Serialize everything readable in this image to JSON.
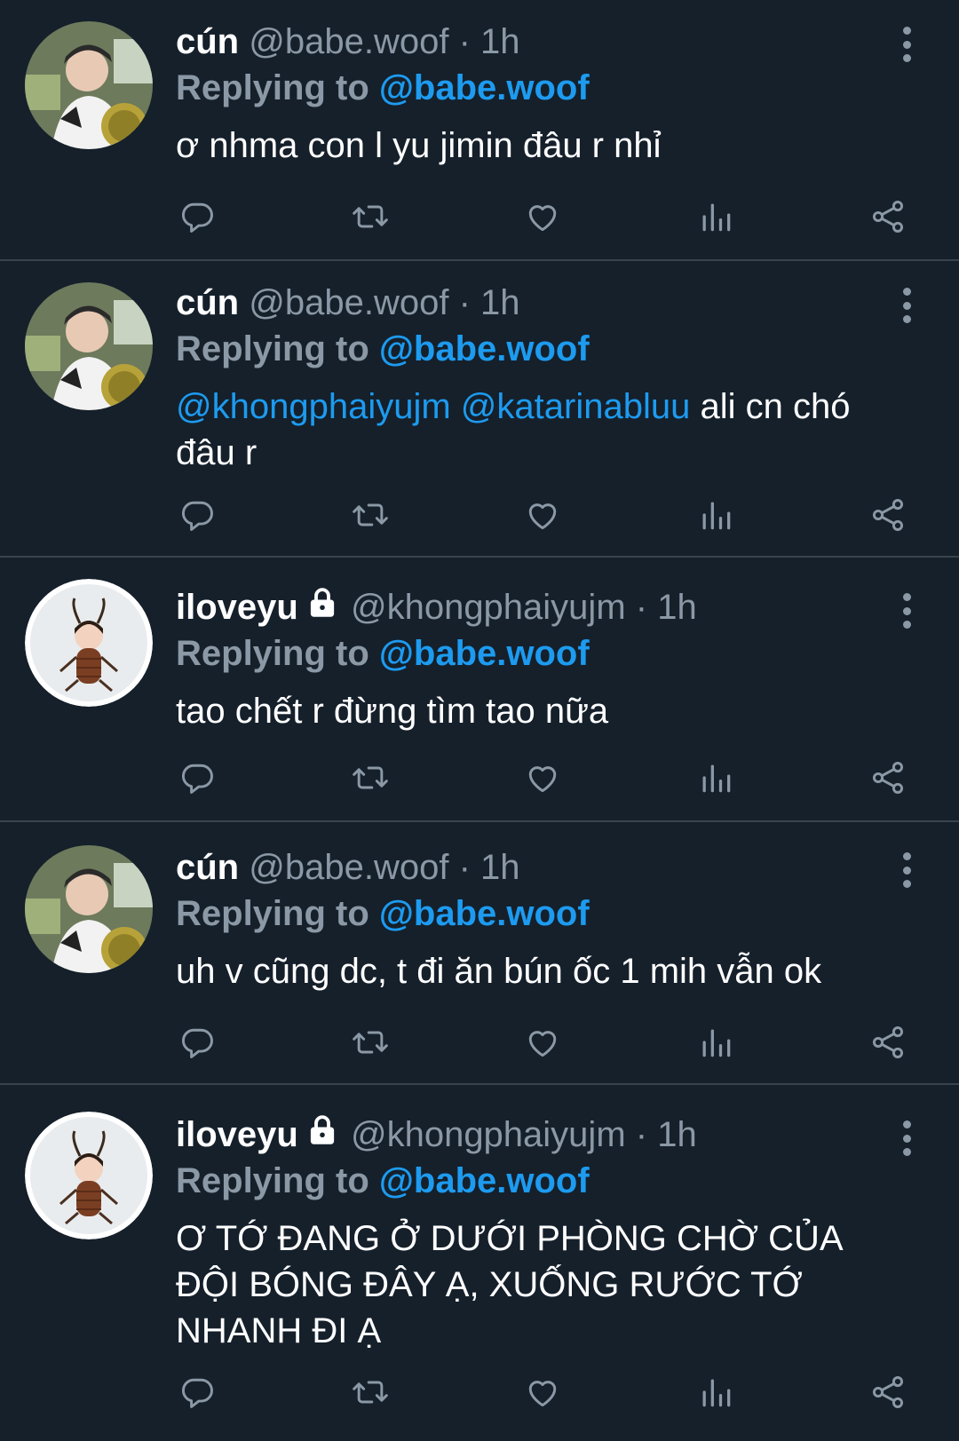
{
  "tweets": [
    {
      "name": "cún",
      "handle": "@babe.woof",
      "dot": "·",
      "time": "1h",
      "replying_prefix": "Replying to",
      "replying_to": "@babe.woof",
      "mentions": [],
      "text": "ơ nhma con l yu jimin đâu r nhỉ",
      "locked": false,
      "avatar": "person-photo"
    },
    {
      "name": "cún",
      "handle": "@babe.woof",
      "dot": "·",
      "time": "1h",
      "replying_prefix": "Replying to",
      "replying_to": "@babe.woof",
      "mentions": [
        "@khongphaiyujm",
        "@katarinabluu"
      ],
      "text": "ali cn chó đâu r",
      "locked": false,
      "avatar": "person-photo"
    },
    {
      "name": "iloveyu",
      "handle": "@khongphaiyujm",
      "dot": "·",
      "time": "1h",
      "replying_prefix": "Replying to",
      "replying_to": "@babe.woof",
      "mentions": [],
      "text": "tao chết r đừng tìm tao nữa",
      "locked": true,
      "avatar": "cockroach-cartoon"
    },
    {
      "name": "cún",
      "handle": "@babe.woof",
      "dot": "·",
      "time": "1h",
      "replying_prefix": "Replying to",
      "replying_to": "@babe.woof",
      "mentions": [],
      "text": "uh v cũng dc, t đi ăn bún ốc 1 mih vẫn ok",
      "locked": false,
      "avatar": "person-photo"
    },
    {
      "name": "iloveyu",
      "handle": "@khongphaiyujm",
      "dot": "·",
      "time": "1h",
      "replying_prefix": "Replying to",
      "replying_to": "@babe.woof",
      "mentions": [],
      "text": "Ơ TỚ ĐANG Ở DƯỚI PHÒNG CHỜ CỦA ĐỘI BÓNG ĐÂY Ạ, XUỐNG RƯỚC TỚ NHANH ĐI Ạ",
      "locked": true,
      "avatar": "cockroach-cartoon"
    }
  ],
  "icons": {
    "reply": "reply-icon",
    "retweet": "retweet-icon",
    "like": "like-icon",
    "views": "views-icon",
    "share": "share-icon",
    "more": "more-options-icon",
    "lock": "lock-icon"
  },
  "colors": {
    "background": "#15202b",
    "divider": "#38444d",
    "secondary_text": "#8b98a5",
    "link": "#1d9bf0"
  }
}
